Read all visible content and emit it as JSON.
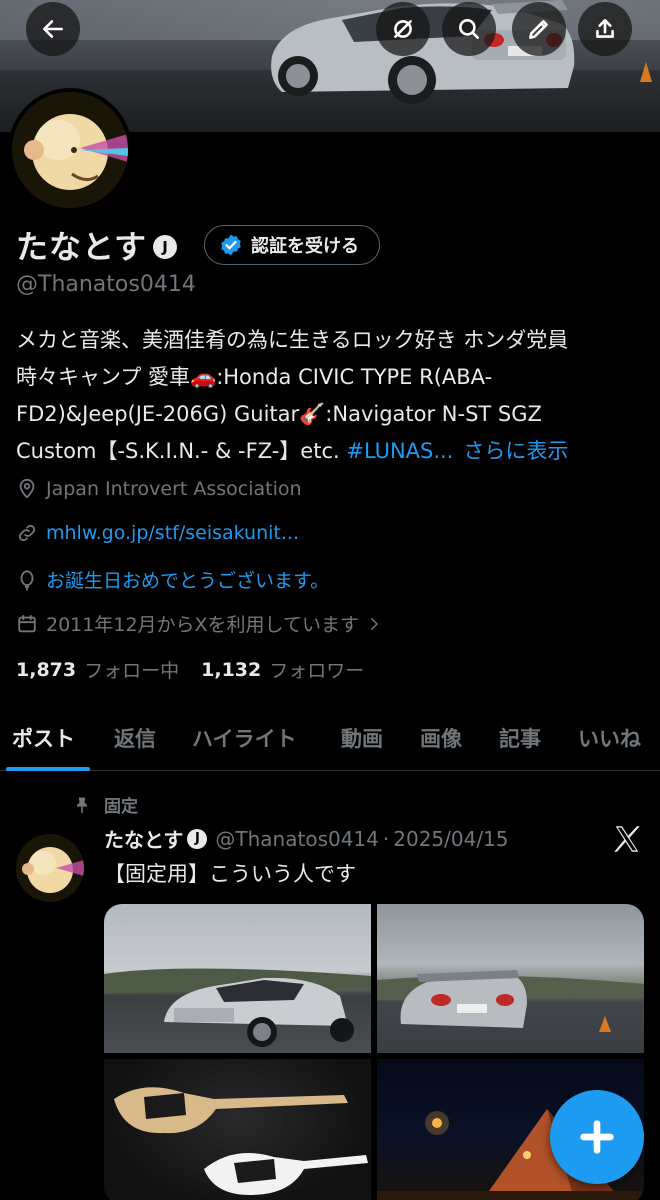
{
  "header": {
    "back_icon": "back-arrow-icon",
    "grok_icon": "grok-icon",
    "search_icon": "search-icon",
    "edit_icon": "edit-icon",
    "share_icon": "share-icon"
  },
  "profile": {
    "display_name": "たなとす",
    "badge": "J",
    "verify_button": "認証を受ける",
    "handle": "@Thanatos0414",
    "bio_lines": [
      "メカと音楽、美酒佳肴の為に生きるロック好き ホンダ党員",
      "時々キャンプ 愛車🚗:Honda CIVIC TYPE R(ABA-",
      "FD2)&Jeep(JE-206G) Guitar🎸:Navigator N-ST SGZ"
    ],
    "bio_last_line": "Custom【-S.K.I.N.- & -FZ-】etc. ",
    "bio_hashtag": "#LUNAS...",
    "bio_more": "さらに表示",
    "location": "Japan Introvert Association",
    "website": "mhlw.go.jp/stf/seisakunit...",
    "birthday": "お誕生日おめでとうございます。",
    "joined": "2011年12月からXを利用しています",
    "following_count": "1,873",
    "following_label": "フォロー中",
    "followers_count": "1,132",
    "followers_label": "フォロワー"
  },
  "tabs": [
    "ポスト",
    "返信",
    "ハイライト",
    "動画",
    "画像",
    "記事",
    "いいね"
  ],
  "active_tab": 0,
  "post": {
    "pinned_label": "固定",
    "author_name": "たなとす",
    "author_badge": "J",
    "author_handle": "@Thanatos0414",
    "separator": "·",
    "date": "2025/04/15",
    "text": "【固定用】こういう人です"
  },
  "colors": {
    "accent": "#1d9bf0",
    "muted": "#71767b",
    "text": "#e7e9ea",
    "background": "#000000"
  }
}
